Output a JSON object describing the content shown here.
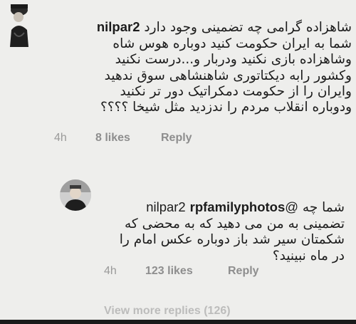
{
  "comment": {
    "username": "nilpar2",
    "first_line_text": "شاهزاده گرامی چه تضمینی وجود دارد",
    "body_lines": "شما به ایران حکومت کنید دوباره هوس شاه\nوشاهزاده بازی نکنید ودربار و...درست نکنید\nوکشور رابه دیکتاتوری شاهنشاهی سوق ندهید\nوایران را از حکومت دمکراتیک دور تر نکنید\nودوباره انقلاب مردم را ندزدید مثل شیخا ؟؟؟؟",
    "time": "4h",
    "likes": "8 likes",
    "reply_label": "Reply",
    "avatar_icon": "profile-avatar-dark-figure"
  },
  "reply": {
    "username": "rpfamilyphotos",
    "mention": "@nilpar2",
    "first_line_text": "شما چه",
    "body_lines": "تضمینی به من می دهید که به محضی که\nشکمتان سیر شد باز دوباره عکس امام را\nدر ماه نبینید؟",
    "time": "4h",
    "likes": "123 likes",
    "reply_label": "Reply",
    "avatar_icon": "profile-avatar-photo"
  },
  "view_replies": "View more replies (126)",
  "colors": {
    "background": "#eeeeec",
    "text": "#1c1c1c",
    "meta": "#9a9a9a"
  }
}
